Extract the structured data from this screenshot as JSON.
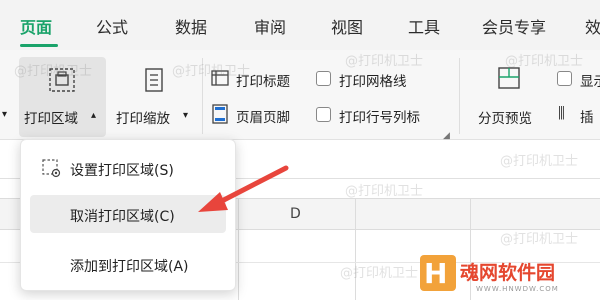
{
  "tabs": [
    {
      "label": "页面",
      "active": true
    },
    {
      "label": "公式"
    },
    {
      "label": "数据"
    },
    {
      "label": "审阅"
    },
    {
      "label": "视图"
    },
    {
      "label": "工具"
    },
    {
      "label": "会员专享"
    },
    {
      "label": "效"
    }
  ],
  "ribbon": {
    "print_area": {
      "label": "打印区域",
      "icon": "print-area-icon"
    },
    "print_scale": {
      "label": "打印缩放",
      "icon": "print-scale-icon"
    },
    "print_titles": {
      "label": "打印标题",
      "icon": "print-titles-icon"
    },
    "header_footer": {
      "label": "页眉页脚",
      "icon": "header-footer-icon"
    },
    "print_gridlines": {
      "label": "打印网格线",
      "checked": false
    },
    "print_row_col_headers": {
      "label": "打印行号列标",
      "checked": false
    },
    "page_break_preview": {
      "label": "分页预览",
      "icon": "page-break-preview-icon"
    },
    "show_partial": {
      "label": "显示",
      "checked": false
    },
    "insert_partial": {
      "label": "插"
    }
  },
  "dropdown": {
    "items": [
      {
        "label": "设置打印区域(S)",
        "icon": "set-print-area-icon"
      },
      {
        "label": "取消打印区域(C)",
        "highlighted": true
      },
      {
        "label": "添加到打印区域(A)"
      }
    ]
  },
  "sheet": {
    "columns": [
      "D"
    ]
  },
  "watermark": "@打印机卫士",
  "logo": {
    "name": "魂网软件园",
    "url": "WWW.HNWDW.COM"
  },
  "colors": {
    "accent": "#1aa36a",
    "arrow": "#e8453c",
    "logo_orange": "#f2a23a",
    "logo_red": "#e5472f"
  }
}
